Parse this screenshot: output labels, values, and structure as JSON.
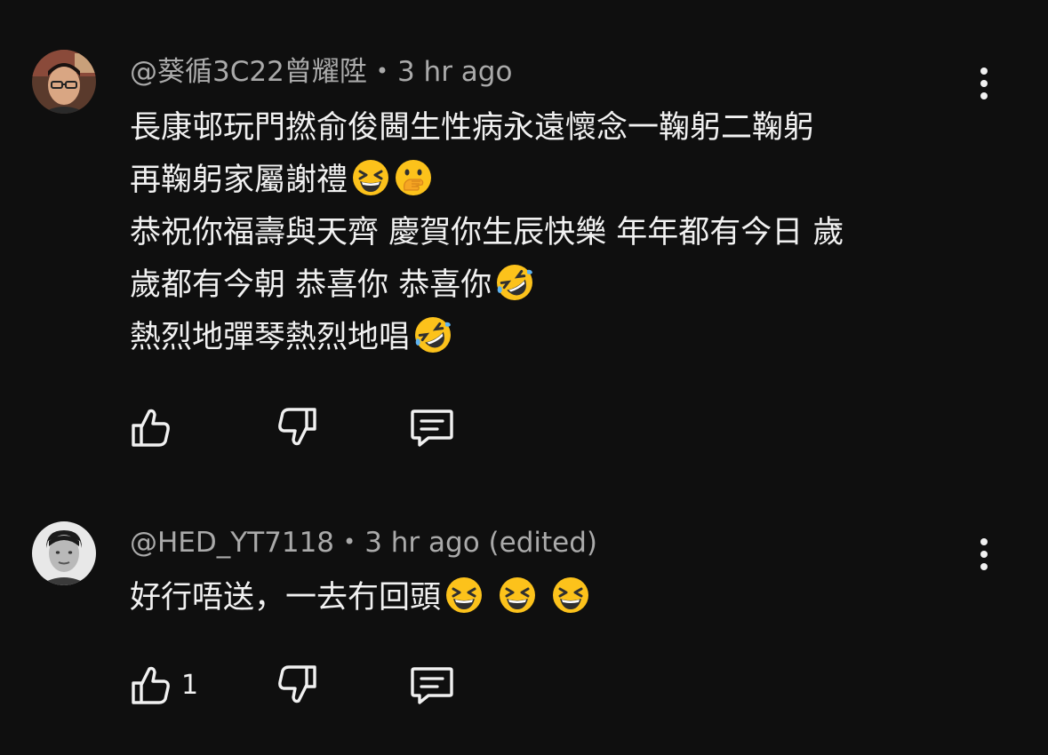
{
  "colors": {
    "background": "#0f0f0f",
    "text": "#f1f1f1",
    "meta": "#aaaaaa"
  },
  "comments": [
    {
      "author": "@葵循3C22曾耀陞",
      "separator": "•",
      "time": "3 hr ago",
      "edited": "",
      "lines": [
        {
          "text": "長康邨玩門撚俞俊閪生性病永遠懷念一鞠躬二鞠躬",
          "emojis": []
        },
        {
          "text": "再鞠躬家屬謝禮",
          "emojis": [
            "grinning-squinting-face",
            "face-with-hand-over-mouth"
          ]
        },
        {
          "text": "恭祝你福壽與天齊 慶賀你生辰快樂 年年都有今日 歲",
          "emojis": []
        },
        {
          "text": "歲都有今朝 恭喜你 恭喜你",
          "emojis": [
            "rolling-on-floor-laughing"
          ]
        },
        {
          "text": "熱烈地彈琴熱烈地唱",
          "emojis": [
            "rolling-on-floor-laughing"
          ]
        }
      ],
      "like_count": "",
      "icons": [
        "thumbs-up-icon",
        "thumbs-down-icon",
        "reply-icon",
        "more-vertical-icon"
      ]
    },
    {
      "author": "@HED_YT7118",
      "separator": "•",
      "time": "3 hr ago",
      "edited": "(edited)",
      "lines": [
        {
          "text": "好行唔送，一去冇回頭",
          "emojis": [
            "grinning-squinting-face",
            "grinning-squinting-face",
            "grinning-squinting-face"
          ]
        }
      ],
      "like_count": "1",
      "icons": [
        "thumbs-up-icon",
        "thumbs-down-icon",
        "reply-icon",
        "more-vertical-icon"
      ]
    }
  ]
}
